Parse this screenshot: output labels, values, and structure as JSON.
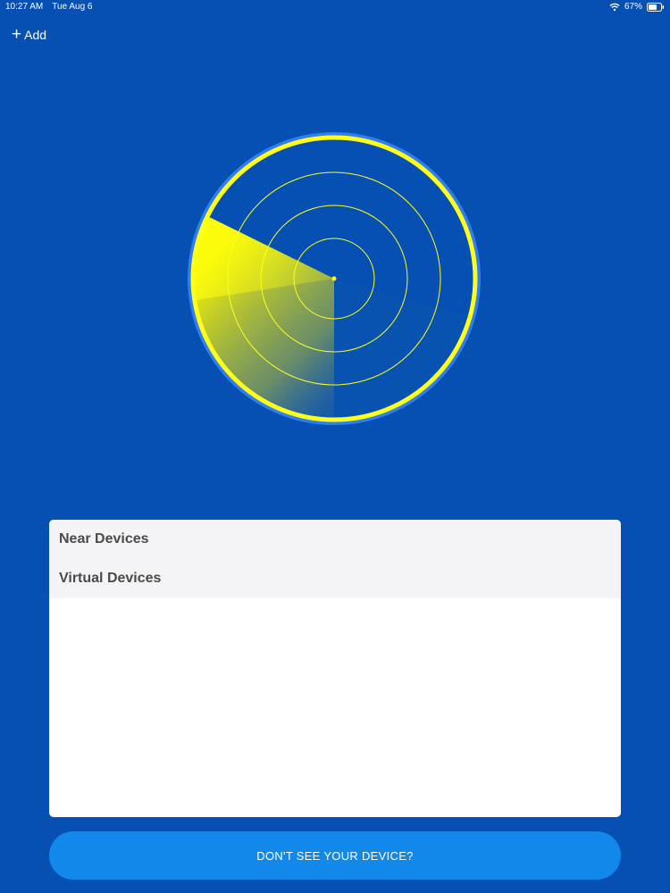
{
  "status_bar": {
    "time": "10:27 AM",
    "date": "Tue Aug 6",
    "battery": "67%",
    "wifi_icon": "wifi-icon",
    "battery_icon": "battery-icon"
  },
  "header": {
    "add_icon": "plus-icon",
    "add_label": "Add"
  },
  "radar": {
    "ring_color": "#ffff1a",
    "outer_glow": "#2f7ff0",
    "background": "#0650b4"
  },
  "devices_panel": {
    "sections": [
      {
        "label": "Near Devices"
      },
      {
        "label": "Virtual Devices"
      }
    ]
  },
  "footer": {
    "help_button_label": "DON'T SEE YOUR DEVICE?"
  },
  "colors": {
    "background": "#0650b4",
    "accent_button": "#1288ea",
    "panel_header": "#f4f4f6"
  }
}
